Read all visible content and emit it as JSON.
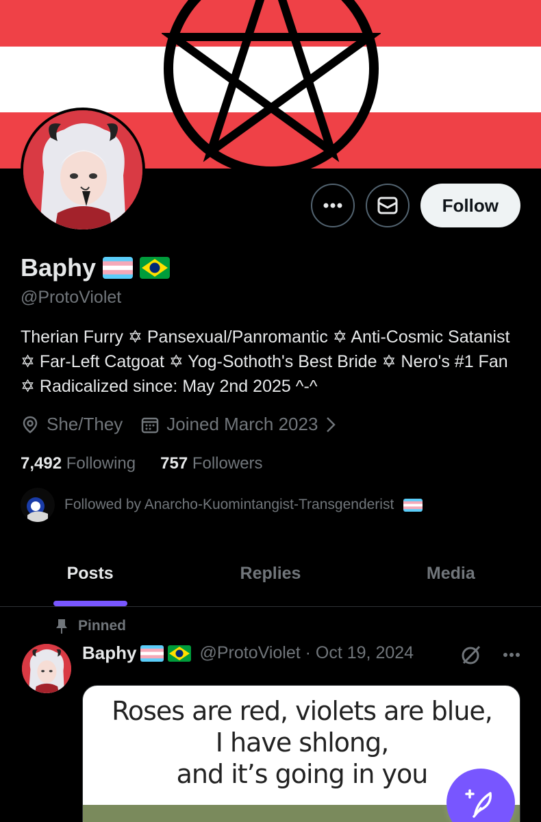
{
  "profile": {
    "name": "Baphy",
    "handle": "@ProtoViolet",
    "bio": "Therian Furry ✡ Pansexual/Panromantic ✡ Anti-Cosmic Satanist ✡ Far-Left Catgoat ✡ Yog-Sothoth's Best Bride ✡ Nero's #1 Fan ✡ Radicalized since: May 2nd 2025 ^-^",
    "pronouns": "She/They",
    "joined": "Joined March 2023",
    "following_count": "7,492",
    "following_label": "Following",
    "followers_count": "757",
    "followers_label": "Followers",
    "followed_by": "Followed by Anarcho-Kuomintangist-Transgenderist"
  },
  "actions": {
    "more_icon": "ellipsis-icon",
    "message_icon": "envelope-icon",
    "follow_label": "Follow"
  },
  "tabs": [
    {
      "label": "Posts",
      "active": true
    },
    {
      "label": "Replies",
      "active": false
    },
    {
      "label": "Media",
      "active": false
    }
  ],
  "post": {
    "pinned_label": "Pinned",
    "author_name": "Baphy",
    "author_handle_date": "@ProtoViolet · Oct 19, 2024",
    "image_text_line1": "Roses are red, violets are blue,",
    "image_text_line2": "I have shlong,",
    "image_text_line3": "and it’s going in you"
  },
  "colors": {
    "accent": "#7856ff",
    "banner_red": "#ef4147",
    "muted": "#71767b",
    "text": "#e7e9ea"
  }
}
